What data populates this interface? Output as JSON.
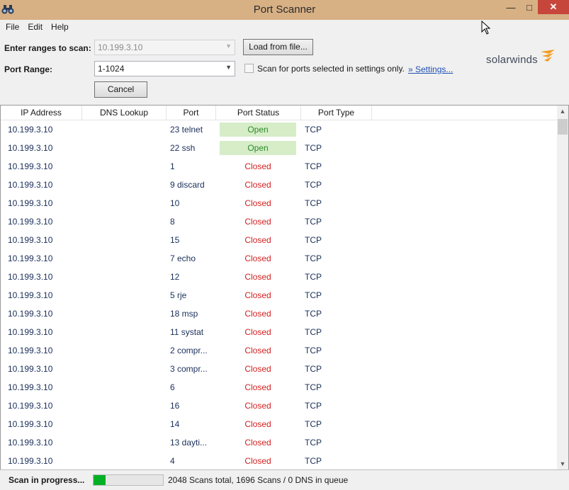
{
  "window": {
    "title": "Port Scanner",
    "minimize_glyph": "—",
    "maximize_glyph": "□",
    "close_glyph": "✕"
  },
  "menu": [
    "File",
    "Edit",
    "Help"
  ],
  "controls": {
    "ranges_label": "Enter ranges to scan:",
    "ranges_value": "10.199.3.10",
    "load_button": "Load from file...",
    "port_range_label": "Port Range:",
    "port_range_value": "1-1024",
    "scan_settings_checkbox_label": "Scan for ports selected in settings only.",
    "scan_settings_checked": false,
    "settings_link": "» Settings...",
    "cancel_button": "Cancel"
  },
  "logo": {
    "text": "solarwinds",
    "accent_color": "#f39c1f"
  },
  "table": {
    "columns": [
      "IP Address",
      "DNS Lookup",
      "Port",
      "Port Status",
      "Port Type"
    ],
    "rows": [
      {
        "ip": "10.199.3.10",
        "dns": "",
        "port": "23 telnet",
        "status": "Open",
        "type": "TCP"
      },
      {
        "ip": "10.199.3.10",
        "dns": "",
        "port": "22 ssh",
        "status": "Open",
        "type": "TCP"
      },
      {
        "ip": "10.199.3.10",
        "dns": "",
        "port": "1",
        "status": "Closed",
        "type": "TCP"
      },
      {
        "ip": "10.199.3.10",
        "dns": "",
        "port": "9 discard",
        "status": "Closed",
        "type": "TCP"
      },
      {
        "ip": "10.199.3.10",
        "dns": "",
        "port": "10",
        "status": "Closed",
        "type": "TCP"
      },
      {
        "ip": "10.199.3.10",
        "dns": "",
        "port": "8",
        "status": "Closed",
        "type": "TCP"
      },
      {
        "ip": "10.199.3.10",
        "dns": "",
        "port": "15",
        "status": "Closed",
        "type": "TCP"
      },
      {
        "ip": "10.199.3.10",
        "dns": "",
        "port": "7 echo",
        "status": "Closed",
        "type": "TCP"
      },
      {
        "ip": "10.199.3.10",
        "dns": "",
        "port": "12",
        "status": "Closed",
        "type": "TCP"
      },
      {
        "ip": "10.199.3.10",
        "dns": "",
        "port": "5 rje",
        "status": "Closed",
        "type": "TCP"
      },
      {
        "ip": "10.199.3.10",
        "dns": "",
        "port": "18 msp",
        "status": "Closed",
        "type": "TCP"
      },
      {
        "ip": "10.199.3.10",
        "dns": "",
        "port": "11 systat",
        "status": "Closed",
        "type": "TCP"
      },
      {
        "ip": "10.199.3.10",
        "dns": "",
        "port": "2 compr...",
        "status": "Closed",
        "type": "TCP"
      },
      {
        "ip": "10.199.3.10",
        "dns": "",
        "port": "3 compr...",
        "status": "Closed",
        "type": "TCP"
      },
      {
        "ip": "10.199.3.10",
        "dns": "",
        "port": "6",
        "status": "Closed",
        "type": "TCP"
      },
      {
        "ip": "10.199.3.10",
        "dns": "",
        "port": "16",
        "status": "Closed",
        "type": "TCP"
      },
      {
        "ip": "10.199.3.10",
        "dns": "",
        "port": "14",
        "status": "Closed",
        "type": "TCP"
      },
      {
        "ip": "10.199.3.10",
        "dns": "",
        "port": "13 dayti...",
        "status": "Closed",
        "type": "TCP"
      },
      {
        "ip": "10.199.3.10",
        "dns": "",
        "port": "4",
        "status": "Closed",
        "type": "TCP"
      }
    ]
  },
  "status": {
    "label": "Scan in progress...",
    "progress_fraction": 0.17,
    "summary": "2048 Scans total, 1696 Scans / 0 DNS in queue"
  },
  "icons": {
    "app": "binoculars-icon",
    "dropdown": "chevron-down-icon",
    "scroll_up": "scroll-up-icon",
    "scroll_down": "scroll-down-icon",
    "cursor": "mouse-pointer-icon"
  },
  "colors": {
    "open_bg": "#d6edc8",
    "open_text": "#2c8a2c",
    "closed_text": "#d42020",
    "progress": "#06b025",
    "titlebar": "#d7b084",
    "close_button": "#c7463c"
  }
}
